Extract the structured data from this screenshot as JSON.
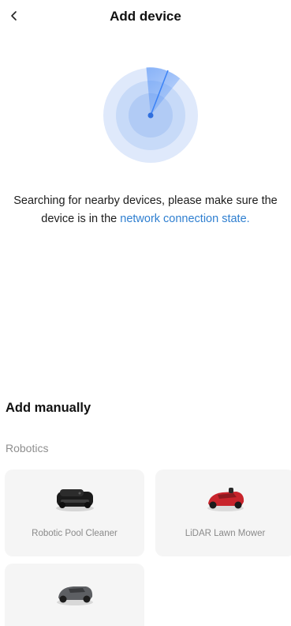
{
  "header": {
    "title": "Add device"
  },
  "search": {
    "message_prefix": "Searching for nearby devices, please make sure the device is in the ",
    "message_link": "network connection state."
  },
  "manual": {
    "title": "Add manually",
    "category": "Robotics",
    "devices": [
      {
        "label": "Robotic Pool Cleaner",
        "icon": "pool-cleaner-image"
      },
      {
        "label": "LiDAR Lawn Mower",
        "icon": "lawn-mower-red-image"
      },
      {
        "label": "",
        "icon": "lawn-mower-gray-image"
      }
    ]
  },
  "colors": {
    "accent": "#2f7fd0",
    "radar": "#3b82f6",
    "card_bg": "#f5f5f5"
  }
}
